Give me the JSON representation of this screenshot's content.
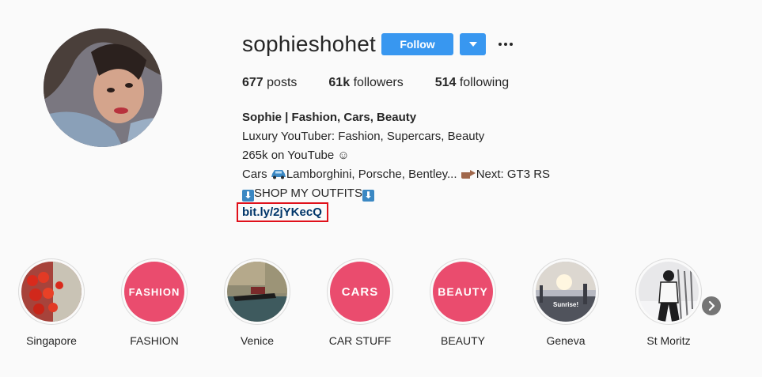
{
  "profile": {
    "username": "sophieshohet",
    "follow_label": "Follow",
    "dropdown_icon": "triangle-down-icon",
    "more_icon": "ellipsis-icon"
  },
  "stats": {
    "posts_count": "677",
    "posts_label": "posts",
    "followers_count": "61k",
    "followers_label": "followers",
    "following_count": "514",
    "following_label": "following"
  },
  "bio": {
    "full_name": "Sophie | Fashion, Cars, Beauty",
    "line1": "Luxury YouTuber: Fashion, Supercars, Beauty",
    "line2": "265k on YouTube ☺",
    "line3_a": "Cars ",
    "line3_b": "Lamborghini, Porsche, Bentley... ",
    "line3_c": "Next: GT3 RS",
    "line4": "SHOP MY OUTFITS",
    "link": "bit.ly/2jYKecQ",
    "emoji_car": "car-emoji",
    "emoji_point": "pointing-hand-emoji",
    "emoji_arrow": "down-arrow-emoji"
  },
  "highlights": [
    {
      "label": "Singapore",
      "cover_text": ""
    },
    {
      "label": "FASHION",
      "cover_text": "FASHION"
    },
    {
      "label": "Venice",
      "cover_text": ""
    },
    {
      "label": "CAR STUFF",
      "cover_text": "CARS"
    },
    {
      "label": "BEAUTY",
      "cover_text": "BEAUTY"
    },
    {
      "label": "Geneva",
      "cover_text": "Sunrise!"
    },
    {
      "label": "St Moritz",
      "cover_text": ""
    }
  ],
  "colors": {
    "accent": "#3897f0",
    "highlight_pink": "#ea4c6e",
    "link": "#003569",
    "annotation_box": "#e0101a"
  }
}
